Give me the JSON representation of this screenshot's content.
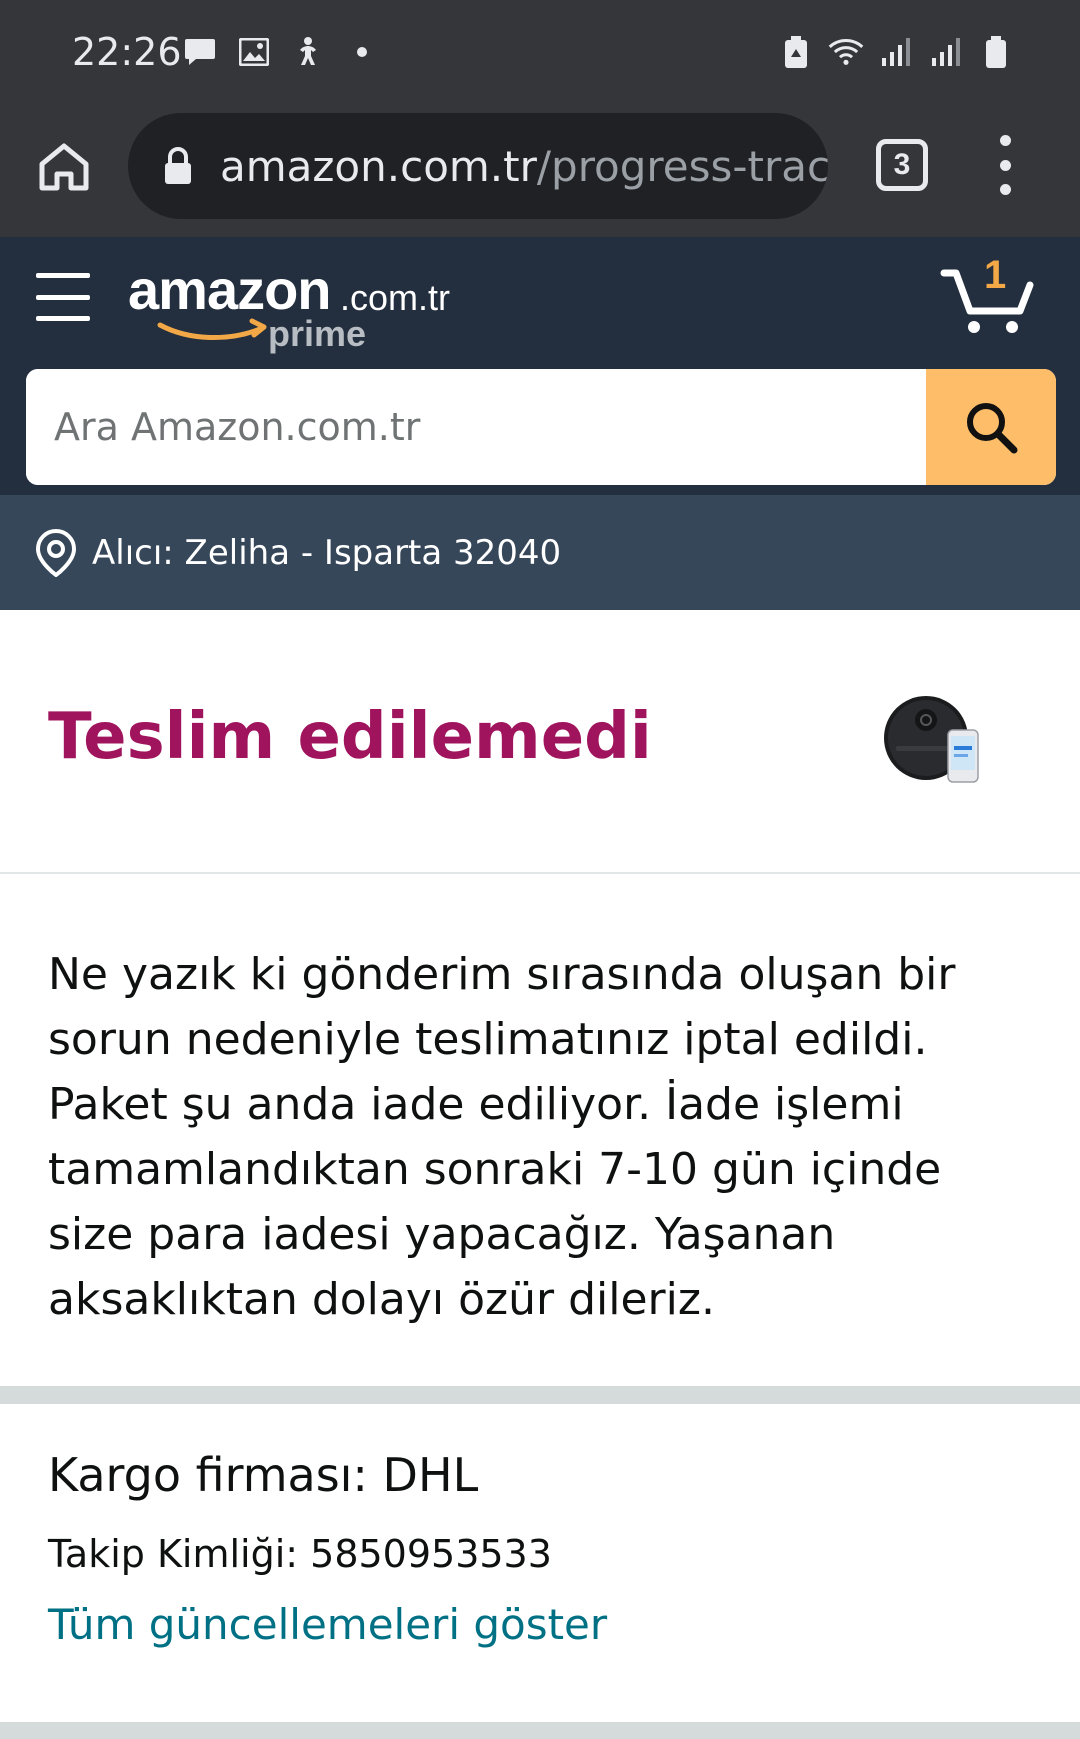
{
  "status_bar": {
    "time": "22:26"
  },
  "browser": {
    "url_domain": "amazon.com.tr",
    "url_path": "/progress-trac",
    "tab_count": "3"
  },
  "header": {
    "logo_text": "amazon",
    "logo_tld": ".com.tr",
    "logo_sub": "prime",
    "cart_count": "1",
    "search_placeholder": "Ara Amazon.com.tr"
  },
  "delivery": {
    "text": "Alıcı: Zeliha - Isparta 32040"
  },
  "shipment": {
    "status_title": "Teslim edilemedi",
    "message": "Ne yazık ki gönderim sırasında oluşan bir sorun nedeniyle teslimatınız iptal edildi. Paket şu anda iade ediliyor. İade işlemi tamamlandıktan sonraki 7-10 gün içinde size para iadesi yapacağız. Yaşanan aksaklıktan dolayı özür dileriz.",
    "carrier": "Kargo firması: DHL",
    "tracking": "Takip Kimliği: 5850953533",
    "show_updates_link": "Tüm güncellemeleri göster"
  },
  "colors": {
    "status_title": "#a0145e",
    "link": "#007185",
    "header_bg": "#232f3e",
    "subheader_bg": "#37475a",
    "search_button": "#febd69"
  }
}
